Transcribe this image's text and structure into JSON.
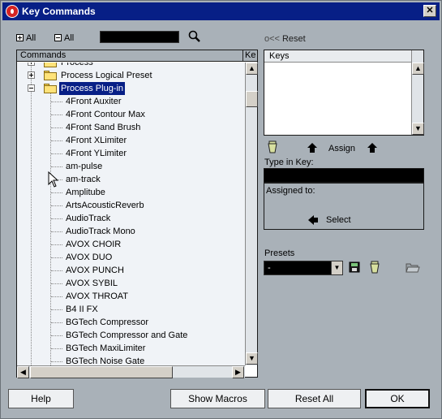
{
  "window": {
    "title": "Key Commands",
    "close_glyph": "✕"
  },
  "toolbar": {
    "expand_all_label": "All",
    "collapse_all_label": "All",
    "search_icon": "magnifier-icon"
  },
  "reset": {
    "prefix": "o<<",
    "label": "Reset"
  },
  "tree": {
    "header_commands": "Commands",
    "header_keys": "Ke",
    "rows": [
      "Process",
      "Process Logical Preset",
      "Process Plug-in",
      "4Front Auxiter",
      "4Front Contour Max",
      "4Front Sand Brush",
      "4Front XLimiter",
      "4Front YLimiter",
      "am-pulse",
      "am-track",
      "Amplitube",
      "ArtsAcousticReverb",
      "AudioTrack",
      "AudioTrack Mono",
      "AVOX CHOIR",
      "AVOX DUO",
      "AVOX PUNCH",
      "AVOX SYBIL",
      "AVOX THROAT",
      "B4 II FX",
      "BGTech Compressor",
      "BGTech Compressor and Gate",
      "BGTech MaxiLimiter",
      "BGTech Noise Gate"
    ]
  },
  "keys": {
    "header": "Keys"
  },
  "assign": {
    "label": "Assign"
  },
  "type_in_key": {
    "label": "Type in Key:"
  },
  "assigned_to": {
    "label": "Assigned to:"
  },
  "select": {
    "label": "Select"
  },
  "presets": {
    "label": "Presets",
    "value": "-"
  },
  "buttons": {
    "help": "Help",
    "show_macros": "Show Macros",
    "reset_all": "Reset All",
    "ok": "OK"
  }
}
